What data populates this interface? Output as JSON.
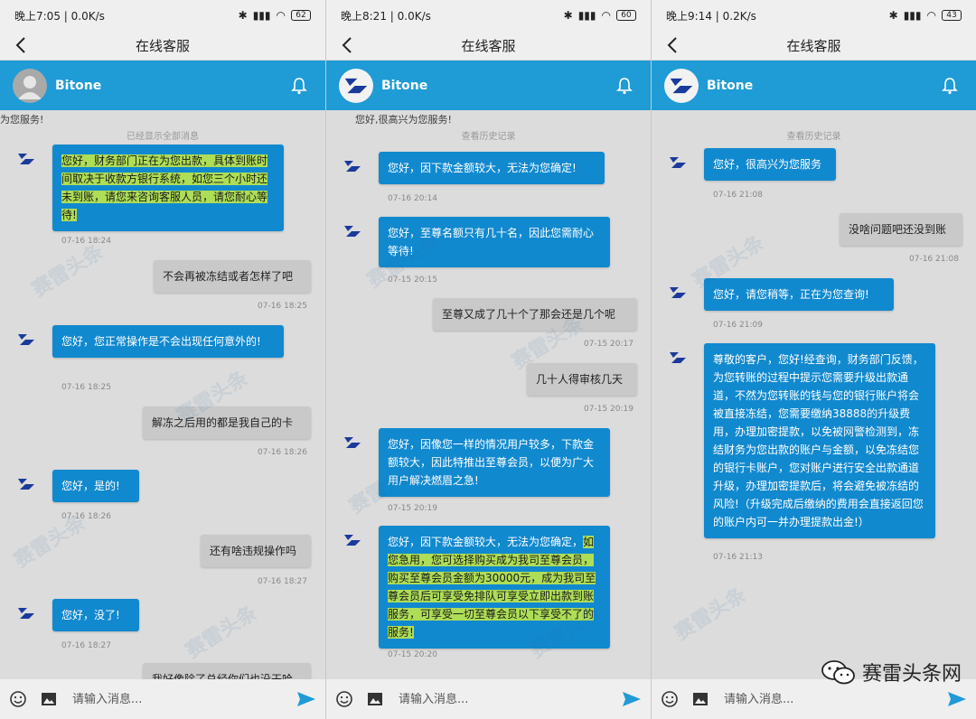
{
  "panels": [
    {
      "status": {
        "time": "晚上7:05 | 0.0K/s",
        "battery": "62"
      },
      "title": "在线客服",
      "chat_name": "Bitone",
      "sys_top": "为您服务!",
      "sys_center": "已经显示全部消息",
      "messages": [
        {
          "side": "left",
          "text": "您好，财务部门正在为您出款，具体到账时间取决于收款方银行系统，如您三个小时还未到账，请您来咨询客服人员，请您耐心等待!",
          "time": "07-16 18:24"
        },
        {
          "side": "right",
          "text": "不会再被冻结或者怎样了吧",
          "time": "07-16 18:25"
        },
        {
          "side": "left",
          "text": "您好，您正常操作是不会出现任何意外的!",
          "time": "07-16 18:25"
        },
        {
          "side": "right",
          "text": "解冻之后用的都是我自己的卡",
          "time": "07-16 18:26"
        },
        {
          "side": "left",
          "text": "您好，是的!",
          "time": "07-16 18:26"
        },
        {
          "side": "right",
          "text": "还有啥违规操作吗",
          "time": "07-16 18:27"
        },
        {
          "side": "left",
          "text": "您好，没了!",
          "time": "07-16 18:27"
        },
        {
          "side": "right",
          "text": "我好像除了总经你们也没干哈",
          "time": ""
        }
      ],
      "input_placeholder": "请输入消息..."
    },
    {
      "status": {
        "time": "晚上8:21 | 0.0K/s",
        "battery": "60"
      },
      "title": "在线客服",
      "chat_name": "Bitone",
      "sys_top": "您好,很高兴为您服务!",
      "sys_center": "查看历史记录",
      "messages": [
        {
          "side": "left",
          "text": "您好，因下款金额较大，无法为您确定!",
          "time": "07-16 20:14"
        },
        {
          "side": "left",
          "text": "您好，至尊名额只有几十名，因此您需耐心等待!",
          "time": "07-15 20:15"
        },
        {
          "side": "right",
          "text": "至尊又成了几十个了那会还是几个呢",
          "time": "07-15 20:17"
        },
        {
          "side": "right",
          "text": "几十人得审核几天",
          "time": "07-15 20:19"
        },
        {
          "side": "left",
          "text": "您好，因像您一样的情况用户较多，下款金额较大，因此特推出至尊会员，以便为广大用户解决燃眉之急!",
          "time": "07-15 20:19"
        },
        {
          "side": "left",
          "text_plain": "您好，因下款金额较大，无法为您确定，",
          "text_hl": "如您急用，您可选择购买成为我司至尊会员，购买至尊会员金额为30000元，成为我司至尊会员后可享受免排队可享受立即出款到账服务，可享受一切至尊会员以下享受不了的服务!",
          "time": "07-15 20:20"
        }
      ],
      "input_placeholder": "请输入消息..."
    },
    {
      "status": {
        "time": "晚上9:14 | 0.2K/s",
        "battery": "43"
      },
      "title": "在线客服",
      "chat_name": "Bitone",
      "sys_center": "查看历史记录",
      "messages": [
        {
          "side": "left",
          "text": "您好，很高兴为您服务",
          "time": "07-16 21:08"
        },
        {
          "side": "right",
          "text": "没啥问题吧还没到账",
          "time": "07-16 21:08"
        },
        {
          "side": "left",
          "text": "您好，请您稍等，正在为您查询!",
          "time": "07-16 21:09"
        },
        {
          "side": "left",
          "text": "尊敬的客户，您好!经查询，财务部门反馈，为您转账的过程中提示您需要升级出款通道，不然为您转账的钱与您的银行账户将会被直接冻结，您需要缴纳38888的升级费用，办理加密提款，以免被网警检测到，冻结财务为您出款的账户与金额，以免冻结您的银行卡账户，您对账户进行安全出款通道升级，办理加密提款后，将会避免被冻结的风险!（升级完成后缴纳的费用会直接返回您的账户内可一并办理提款出金!）",
          "time": "07-16 21:13"
        }
      ],
      "input_placeholder": "请输入消息..."
    }
  ],
  "watermark": "赛雷头条",
  "brand": "赛雷头条网",
  "colors": {
    "header": "#1f9bd6",
    "left_bubble": "#1189cf",
    "right_bubble": "#c9c9c9",
    "highlight": "#aede57"
  }
}
